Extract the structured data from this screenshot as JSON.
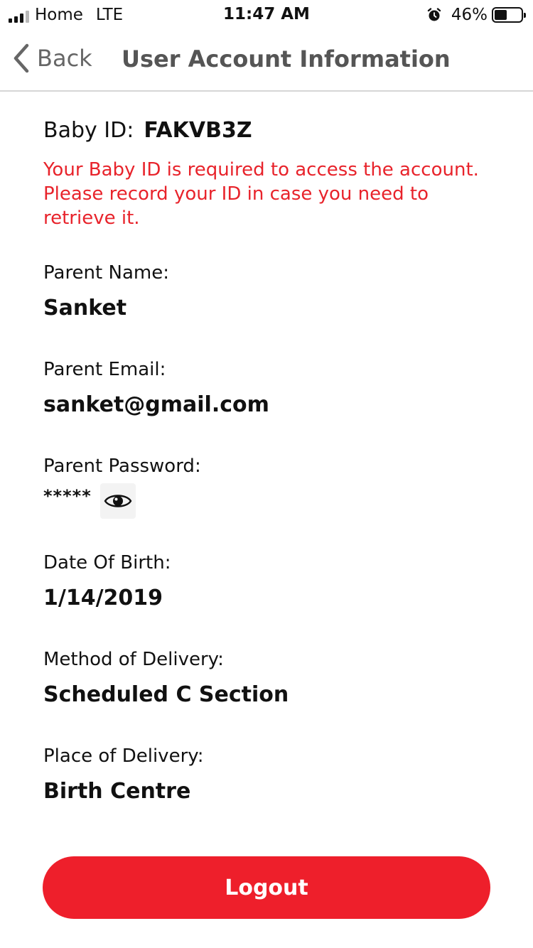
{
  "status_bar": {
    "carrier": "Home",
    "network": "LTE",
    "time": "11:47 AM",
    "battery_percent": "46%",
    "battery_level": 0.46,
    "icons": [
      "signal-icon",
      "alarm-icon",
      "battery-icon"
    ]
  },
  "nav": {
    "back_label": "Back",
    "title": "User Account Information",
    "back_icon": "chevron-left-icon"
  },
  "baby_id": {
    "label": "Baby ID:",
    "value": "FAKVB3Z",
    "notice": "Your Baby ID is required to access the account. Please record your ID in case you need to retrieve it."
  },
  "fields": {
    "parent_name": {
      "label": "Parent Name:",
      "value": "Sanket"
    },
    "parent_email": {
      "label": "Parent Email:",
      "value": "sanket@gmail.com"
    },
    "parent_password": {
      "label": "Parent Password:",
      "value": "*****",
      "toggle_icon": "eye-icon"
    },
    "date_of_birth": {
      "label": "Date Of Birth:",
      "value": "1/14/2019"
    },
    "method_of_delivery": {
      "label": "Method of Delivery:",
      "value": "Scheduled C Section"
    },
    "place_of_delivery": {
      "label": "Place of Delivery:",
      "value": "Birth Centre"
    }
  },
  "logout": {
    "label": "Logout"
  },
  "colors": {
    "accent_red": "#ee1f2b",
    "notice_red": "#e8232b",
    "nav_gray": "#555555",
    "divider": "#d6d6d6"
  }
}
